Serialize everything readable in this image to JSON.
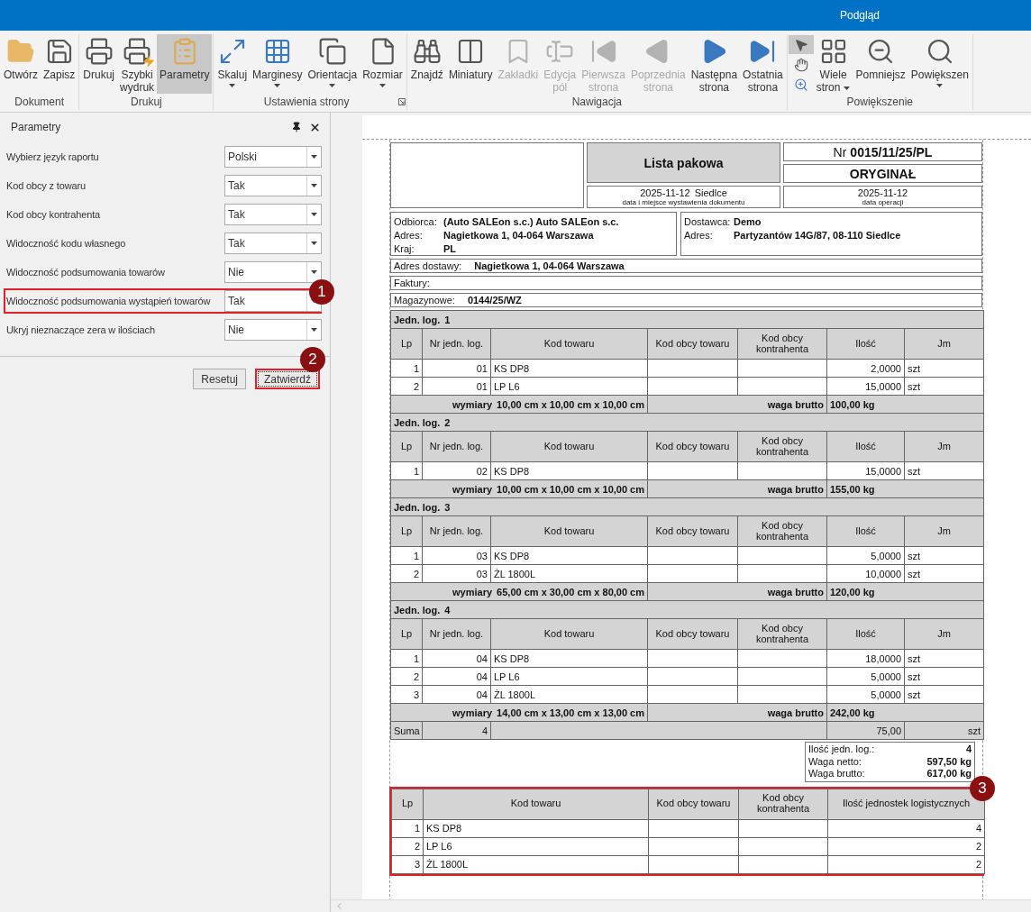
{
  "title_bar": {
    "title": "Podgląd"
  },
  "ribbon": {
    "groups": [
      {
        "label": "Dokument",
        "items": [
          {
            "kind": "large",
            "label": "Otwórz",
            "selected": false,
            "disabled": false,
            "dropdown": false
          },
          {
            "kind": "large",
            "label": "Zapisz",
            "selected": false,
            "disabled": false,
            "dropdown": false
          }
        ]
      },
      {
        "label": "Drukuj",
        "items": [
          {
            "kind": "large",
            "label": "Drukuj",
            "selected": false,
            "disabled": false,
            "dropdown": false
          },
          {
            "kind": "large",
            "label": "Szybki\nwydruk",
            "selected": false,
            "disabled": false,
            "dropdown": false
          },
          {
            "kind": "large",
            "label": "Parametry",
            "selected": true,
            "disabled": false,
            "dropdown": false
          }
        ]
      },
      {
        "label": "Ustawienia strony",
        "launcher": true,
        "items": [
          {
            "kind": "large",
            "label": "Skaluj",
            "selected": false,
            "disabled": false,
            "dropdown": true
          },
          {
            "kind": "large",
            "label": "Marginesy",
            "selected": false,
            "disabled": false,
            "dropdown": true
          },
          {
            "kind": "large",
            "label": "Orientacja",
            "selected": false,
            "disabled": false,
            "dropdown": true
          },
          {
            "kind": "large",
            "label": "Rozmiar",
            "selected": false,
            "disabled": false,
            "dropdown": true
          }
        ]
      },
      {
        "label": "Nawigacja",
        "items": [
          {
            "kind": "large",
            "label": "Znajdź",
            "selected": false,
            "disabled": false,
            "dropdown": false
          },
          {
            "kind": "large",
            "label": "Miniatury",
            "selected": false,
            "disabled": false,
            "dropdown": false
          },
          {
            "kind": "large",
            "label": "Zakładki",
            "selected": false,
            "disabled": true,
            "dropdown": false
          },
          {
            "kind": "large",
            "label": "Edycja\npól",
            "selected": false,
            "disabled": true,
            "dropdown": false
          },
          {
            "kind": "large",
            "label": "Pierwsza\nstrona",
            "selected": false,
            "disabled": true,
            "dropdown": false
          },
          {
            "kind": "large",
            "label": "Poprzednia\nstrona",
            "selected": false,
            "disabled": true,
            "dropdown": false
          },
          {
            "kind": "large",
            "label": "Następna\nstrona",
            "selected": false,
            "disabled": false,
            "dropdown": false
          },
          {
            "kind": "large",
            "label": "Ostatnia\nstrona",
            "selected": false,
            "disabled": false,
            "dropdown": false
          }
        ]
      },
      {
        "label": "Powiększenie",
        "items": [
          {
            "kind": "small",
            "selected": true,
            "disabled": false
          },
          {
            "kind": "small",
            "selected": false,
            "disabled": false
          },
          {
            "kind": "small",
            "selected": false,
            "disabled": false
          },
          {
            "kind": "large",
            "label": "Wiele\nstron",
            "selected": false,
            "disabled": false,
            "dropdown": true
          },
          {
            "kind": "large",
            "label": "Pomniejsz",
            "selected": false,
            "disabled": false,
            "dropdown": false
          },
          {
            "kind": "large",
            "label": "Powiększen",
            "selected": false,
            "disabled": false,
            "dropdown": true
          }
        ]
      }
    ]
  },
  "parameters_panel": {
    "title": "Parametry",
    "options": [
      {
        "label": "Wybierz język raportu",
        "value": "Polski",
        "highlighted": false
      },
      {
        "label": "Kod obcy z towaru",
        "value": "Tak",
        "highlighted": false
      },
      {
        "label": "Kod obcy kontrahenta",
        "value": "Tak",
        "highlighted": false
      },
      {
        "label": "Widoczność kodu własnego",
        "value": "Tak",
        "highlighted": false
      },
      {
        "label": "Widoczność podsumowania towarów",
        "value": "Nie",
        "highlighted": false
      },
      {
        "label": "Widoczność podsumowania wystąpień towarów",
        "value": "Tak",
        "highlighted": true,
        "marker": "1"
      },
      {
        "label": "Ukryj nieznaczące zera w ilościach",
        "value": "Nie",
        "highlighted": false
      }
    ],
    "buttons": [
      {
        "label": "Resetuj",
        "highlighted": false
      },
      {
        "label": "Zatwierdź",
        "highlighted": true,
        "marker": "2"
      }
    ]
  },
  "document": {
    "header": {
      "title": "Lista pakowa",
      "number_prefix": "Nr",
      "number": "0015/11/25/PL",
      "copy": "ORYGINAŁ",
      "issue_date": "2025-11-12",
      "issue_place": "Siedlce",
      "issue_caption": "data i miejsce wystawienia dokumentu",
      "operation_date": "2025-11-12",
      "operation_caption": "data operacji"
    },
    "recipient": [
      {
        "label": "Odbiorca:",
        "value": "(Auto SALEon s.c.) Auto SALEon s.c."
      },
      {
        "label": "Adres:",
        "value": "Nagietkowa 1, 04-064 Warszawa"
      },
      {
        "label": "Kraj:",
        "value": "PL"
      }
    ],
    "supplier": [
      {
        "label": "Dostawca:",
        "value": "Demo"
      },
      {
        "label": "Adres:",
        "value": "Partyzantów 14G/87, 08-110 Siedlce"
      }
    ],
    "info_rows": [
      {
        "label": "Adres dostawy:",
        "value": "Nagietkowa 1, 04-064 Warszawa"
      },
      {
        "label": "Faktury:"
      },
      {
        "label": "Magazynowe:",
        "value": "0144/25/WZ"
      }
    ],
    "units": [
      {
        "title": "Jedn. log.",
        "number": "1",
        "columns": [
          "Lp",
          "Nr jedn. log.",
          "Kod towaru",
          "Kod obcy towaru",
          "Kod obcy kontrahenta",
          "Ilość",
          "Jm"
        ],
        "rows": [
          {
            "lp": "1",
            "unit_no": "01",
            "code": "KS DP8",
            "qty": "2,0000",
            "uom": "szt"
          },
          {
            "lp": "2",
            "unit_no": "01",
            "code": "LP L6",
            "qty": "15,0000",
            "uom": "szt"
          }
        ],
        "dims_label": "wymiary",
        "dims": "10,00 cm x 10,00 cm x 10,00 cm",
        "weight_label": "waga brutto",
        "weight": "100,00 kg"
      },
      {
        "title": "Jedn. log.",
        "number": "2",
        "columns": [
          "Lp",
          "Nr jedn. log.",
          "Kod towaru",
          "Kod obcy towaru",
          "Kod obcy kontrahenta",
          "Ilość",
          "Jm"
        ],
        "rows": [
          {
            "lp": "1",
            "unit_no": "02",
            "code": "KS DP8",
            "qty": "15,0000",
            "uom": "szt"
          }
        ],
        "dims_label": "wymiary",
        "dims": "10,00 cm x 10,00 cm x 10,00 cm",
        "weight_label": "waga brutto",
        "weight": "155,00 kg"
      },
      {
        "title": "Jedn. log.",
        "number": "3",
        "columns": [
          "Lp",
          "Nr jedn. log.",
          "Kod towaru",
          "Kod obcy towaru",
          "Kod obcy kontrahenta",
          "Ilość",
          "Jm"
        ],
        "rows": [
          {
            "lp": "1",
            "unit_no": "03",
            "code": "KS DP8",
            "qty": "5,0000",
            "uom": "szt"
          },
          {
            "lp": "2",
            "unit_no": "03",
            "code": "ŻL 1800L",
            "qty": "10,0000",
            "uom": "szt"
          }
        ],
        "dims_label": "wymiary",
        "dims": "65,00 cm x 30,00 cm x 80,00 cm",
        "weight_label": "waga brutto",
        "weight": "120,00 kg"
      },
      {
        "title": "Jedn. log.",
        "number": "4",
        "columns": [
          "Lp",
          "Nr jedn. log.",
          "Kod towaru",
          "Kod obcy towaru",
          "Kod obcy kontrahenta",
          "Ilość",
          "Jm"
        ],
        "rows": [
          {
            "lp": "1",
            "unit_no": "04",
            "code": "KS DP8",
            "qty": "18,0000",
            "uom": "szt"
          },
          {
            "lp": "2",
            "unit_no": "04",
            "code": "LP L6",
            "qty": "5,0000",
            "uom": "szt"
          },
          {
            "lp": "3",
            "unit_no": "04",
            "code": "ŻL 1800L",
            "qty": "5,0000",
            "uom": "szt"
          }
        ],
        "dims_label": "wymiary",
        "dims": "14,00 cm x 13,00 cm x 13,00 cm",
        "weight_label": "waga brutto",
        "weight": "242,00 kg"
      }
    ],
    "sum_row": {
      "label": "Suma",
      "count": "4",
      "qty": "75,00",
      "uom": "szt"
    },
    "totals": [
      {
        "label": "Ilość jedn. log.:",
        "value": "4"
      },
      {
        "label": "Waga netto:",
        "value": "597,50 kg"
      },
      {
        "label": "Waga brutto:",
        "value": "617,00 kg"
      }
    ],
    "summary": {
      "highlighted": true,
      "marker": "3",
      "columns": [
        "Lp",
        "Kod towaru",
        "Kod obcy towaru",
        "Kod obcy kontrahenta",
        "Ilość jednostek logistycznych"
      ],
      "rows": [
        {
          "lp": "1",
          "code": "KS DP8",
          "count": "4"
        },
        {
          "lp": "2",
          "code": "LP L6",
          "count": "2"
        },
        {
          "lp": "3",
          "code": "ŻL 1800L",
          "count": "2"
        }
      ]
    }
  }
}
